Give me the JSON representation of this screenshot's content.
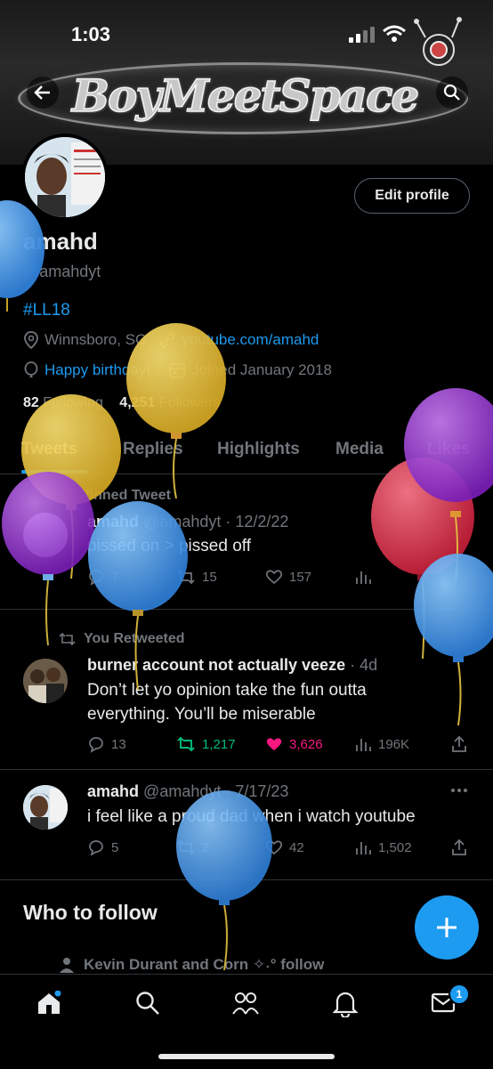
{
  "status_bar": {
    "time": "1:03"
  },
  "header": {
    "banner_text": "BoyMeetSpace"
  },
  "profile": {
    "edit_label": "Edit profile",
    "display_name": "amahd",
    "handle": "@amahdyt",
    "bio": "#LL18",
    "location": "Winnsboro, SC",
    "website": "youtube.com/amahd",
    "birthday": "Happy birthday!",
    "joined": "Joined January 2018",
    "following_count": "82",
    "following_label": "Following",
    "followers_count": "4,251",
    "followers_label": "Followers"
  },
  "tabs": [
    "Tweets",
    "Replies",
    "Highlights",
    "Media",
    "Likes"
  ],
  "tweets": [
    {
      "context": "Pinned Tweet",
      "author": "amahd",
      "handle_date": "@amahdyt · 12/2/22",
      "text": "pissed on > pissed off",
      "replies": "7",
      "retweets": "15",
      "likes": "157",
      "views": ""
    },
    {
      "context": "You Retweeted",
      "author": "burner account not actually veeze",
      "handle_date": "· 4d",
      "text": "Don’t let yo opinion take the fun outta everything. You’ll be miserable",
      "replies": "13",
      "retweets": "1,217",
      "likes": "3,626",
      "views": "196K"
    },
    {
      "context": "",
      "author": "amahd",
      "handle_date": "@amahdyt · 7/17/23",
      "text": "i feel like a proud dad when i watch youtube",
      "replies": "5",
      "retweets": "2",
      "likes": "42",
      "views": "1,502"
    }
  ],
  "who_to_follow": {
    "title": "Who to follow",
    "suggestion_context": "Kevin Durant and Corn ✧˖° follow"
  },
  "bottom_nav": {
    "messages_badge": "1"
  },
  "colors": {
    "accent": "#1d9bf0",
    "retweet_green": "#00ba7c",
    "like_pink": "#f91880",
    "background": "#000000"
  },
  "icons": [
    "back-arrow-icon",
    "search-icon",
    "location-icon",
    "link-icon",
    "balloon-icon",
    "calendar-icon",
    "pin-icon",
    "retweet-icon",
    "reply-icon",
    "like-icon",
    "views-icon",
    "share-icon",
    "more-icon",
    "compose-plus-icon",
    "home-icon",
    "communities-icon",
    "bell-icon",
    "mail-icon"
  ]
}
